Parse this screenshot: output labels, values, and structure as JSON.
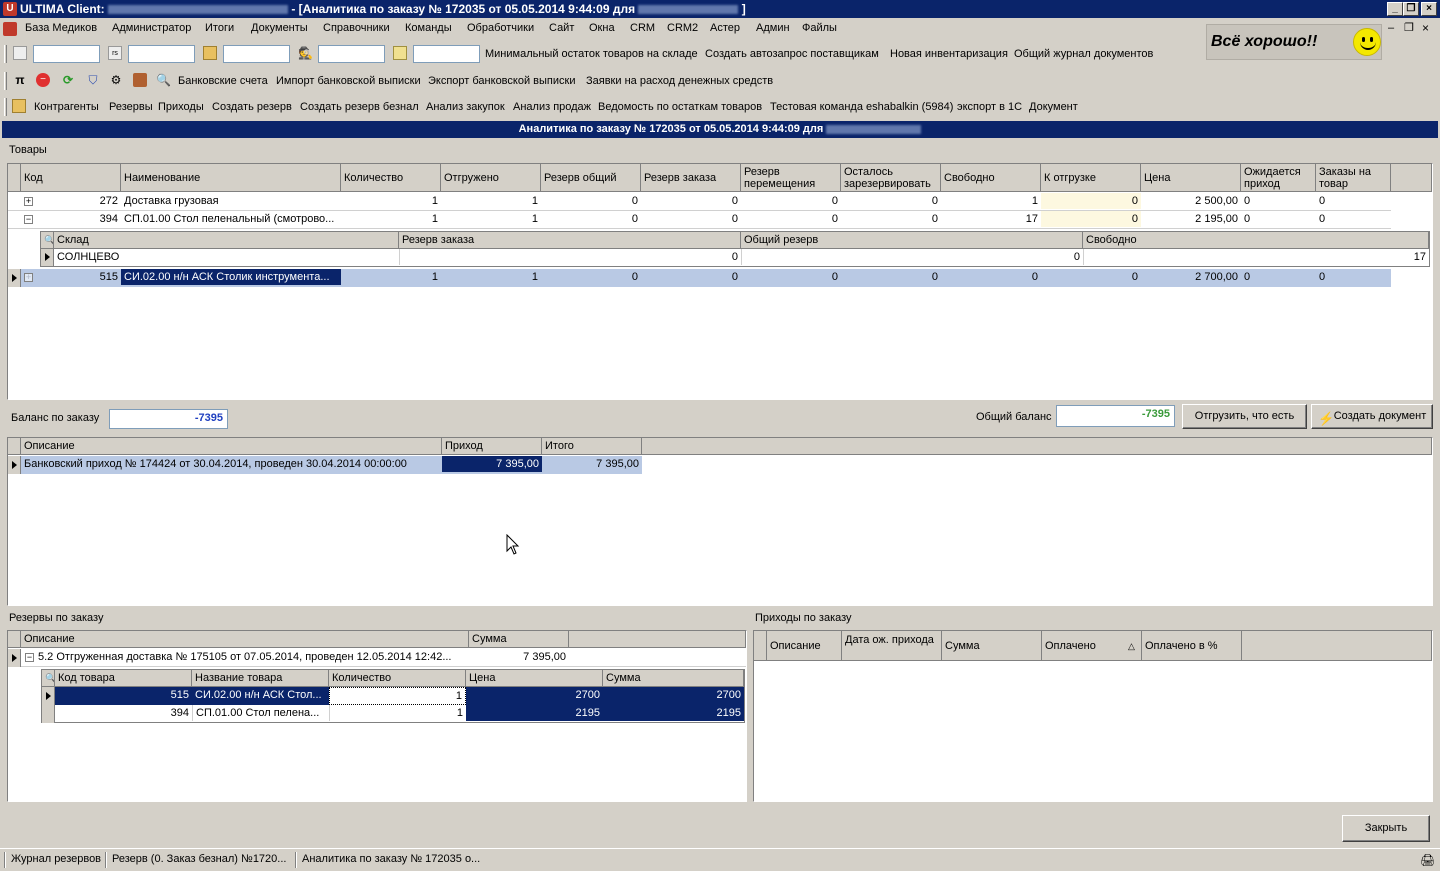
{
  "window": {
    "title_prefix": "ULTIMA Client:",
    "title_main": "- [Аналитика по заказу № 172035 от 05.05.2014 9:44:09 для",
    "title_suffix": "]"
  },
  "menu": [
    "База Медиков",
    "Администратор",
    "Итоги",
    "Документы",
    "Справочники",
    "Команды",
    "Обработчики",
    "Сайт",
    "Окна",
    "CRM",
    "CRM2",
    "Астер",
    "Админ",
    "Файлы"
  ],
  "toolbar1": [
    "Минимальный остаток товаров на складе",
    "Создать автозапрос поставщикам",
    "Новая инвентаризация",
    "Общий журнал документов"
  ],
  "toolbar2": [
    "Банковские счета",
    "Импорт банковской выписки",
    "Экспорт банковской выписки",
    "Заявки на расход денежных средств"
  ],
  "toolbar3": [
    "Контрагенты",
    "Резервы",
    "Приходы",
    "Создать резерв",
    "Создать резерв безнал",
    "Анализ закупок",
    "Анализ продаж",
    "Ведомость по остаткам товаров",
    "Тестовая команда eshabalkin (5984)",
    "экспорт в 1С",
    "Документ"
  ],
  "status_message": "Всё хорошо!!",
  "form_title": "Аналитика по заказу № 172035 от 05.05.2014 9:44:09 для",
  "goods": {
    "section_label": "Товары",
    "columns": [
      "Код",
      "Наименование",
      "Количество",
      "Отгружено",
      "Резерв общий",
      "Резерв заказа",
      "Резерв перемещения",
      "Осталось зарезервировать",
      "Свободно",
      "К отгрузке",
      "Цена",
      "Ожидается приход",
      "Заказы на товар"
    ],
    "rows": [
      {
        "expander": "+",
        "cells": [
          "272",
          "Доставка грузовая",
          "1",
          "1",
          "0",
          "0",
          "0",
          "0",
          "1",
          "0",
          "2 500,00",
          "0",
          "0"
        ]
      },
      {
        "expander": "−",
        "cells": [
          "394",
          "СП.01.00 Стол пеленальный (смотрово...",
          "1",
          "1",
          "0",
          "0",
          "0",
          "0",
          "17",
          "0",
          "2 195,00",
          "0",
          "0"
        ]
      },
      {
        "expander": "+",
        "cells": [
          "515",
          "СИ.02.00 н/н АСК Столик инструмента...",
          "1",
          "1",
          "0",
          "0",
          "0",
          "0",
          "0",
          "0",
          "2 700,00",
          "0",
          "0"
        ]
      }
    ],
    "detail": {
      "columns": [
        "Склад",
        "Резерв заказа",
        "Общий резерв",
        "Свободно"
      ],
      "row": [
        "СОЛНЦЕВО",
        "0",
        "0",
        "17"
      ]
    }
  },
  "balance": {
    "order_label": "Баланс по заказу",
    "order_value": "-7395",
    "total_label": "Общий баланс",
    "total_value": "-7395",
    "ship_button": "Отгрузить, что есть",
    "create_doc_button": "Создать документ"
  },
  "payments": {
    "columns": [
      "Описание",
      "Приход",
      "Итого"
    ],
    "rows": [
      [
        "Банковский приход № 174424 от 30.04.2014, проведен 30.04.2014 00:00:00",
        "7 395,00",
        "7 395,00"
      ]
    ]
  },
  "reserves": {
    "section_label": "Резервы по заказу",
    "columns": [
      "Описание",
      "Сумма"
    ],
    "row": [
      "5.2 Отгруженная доставка № 175105 от 07.05.2014, проведен 12.05.2014 12:42...",
      "7 395,00"
    ],
    "sub_columns": [
      "Код товара",
      "Название товара",
      "Количество",
      "Цена",
      "Сумма"
    ],
    "sub_rows": [
      [
        "515",
        "СИ.02.00 н/н АСК Стол...",
        "1",
        "2700",
        "2700"
      ],
      [
        "394",
        "СП.01.00 Стол пелена...",
        "1",
        "2195",
        "2195"
      ]
    ]
  },
  "incomes": {
    "section_label": "Приходы по заказу",
    "columns": [
      "Описание",
      "Дата ож. прихода",
      "Сумма",
      "Оплачено",
      "Оплачено в %"
    ]
  },
  "close_button": "Закрыть",
  "statusbar": [
    "Журнал резервов",
    "Резерв (0. Заказ безнал) №1720...",
    "Аналитика по заказу № 172035 о..."
  ]
}
